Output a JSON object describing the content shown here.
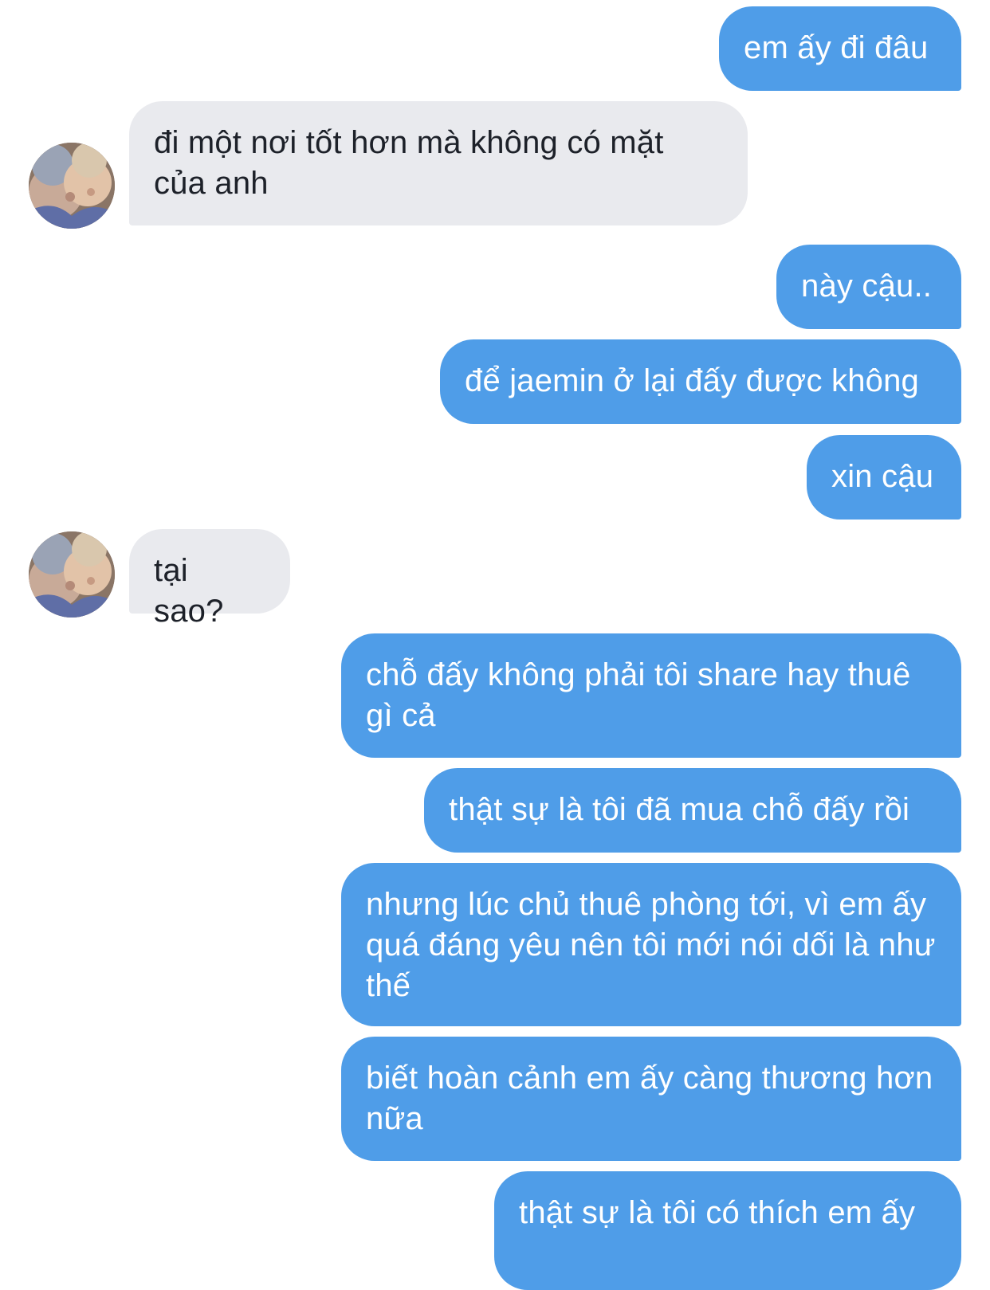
{
  "conversation": {
    "contact_avatar": "contact-photo-avatar",
    "messages": [
      {
        "from": "me",
        "text": "em ấy đi đâu"
      },
      {
        "from": "contact",
        "text": "đi một nơi tốt hơn mà không có mặt của anh"
      },
      {
        "from": "me",
        "text": "này cậu.."
      },
      {
        "from": "me",
        "text": "để jaemin ở lại đấy được không"
      },
      {
        "from": "me",
        "text": "xin cậu"
      },
      {
        "from": "contact",
        "text": "tại sao?"
      },
      {
        "from": "me",
        "text": "chỗ đấy không phải tôi share hay thuê gì cả"
      },
      {
        "from": "me",
        "text": "thật sự là tôi đã mua chỗ đấy rồi"
      },
      {
        "from": "me",
        "text": "nhưng lúc chủ thuê phòng tới, vì em ấy quá đáng yêu nên tôi mới nói dối là như thế"
      },
      {
        "from": "me",
        "text": "biết hoàn cảnh em ấy càng thương hơn nữa"
      },
      {
        "from": "me",
        "text": "thật sự là tôi có thích em ấy"
      }
    ]
  },
  "colors": {
    "outgoing_bubble": "#4f9de8",
    "incoming_bubble": "#e9eaee",
    "background": "#ffffff"
  }
}
